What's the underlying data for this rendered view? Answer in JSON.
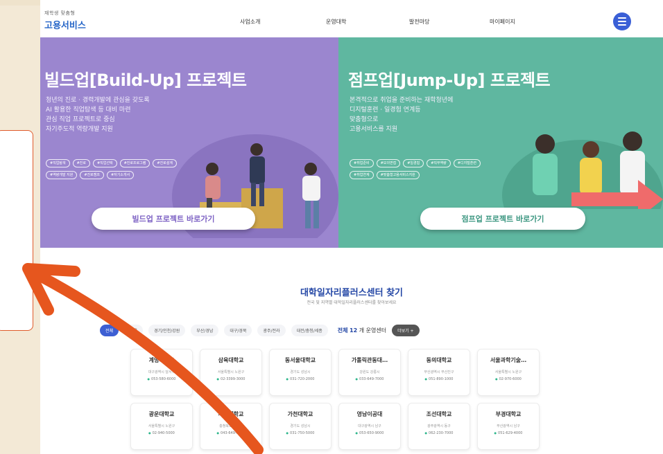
{
  "header": {
    "logo_sub": "재학생 맞춤형",
    "logo_main": "고용서비스",
    "nav": [
      "사업소개",
      "운영대학",
      "발전마당",
      "마이페이지"
    ],
    "menu_icon": "hamburger-menu-icon"
  },
  "hero_left": {
    "title": "빌드업[Build-Up] 프로젝트",
    "desc": [
      "청년의 진로 · 경력개발에 관심을 갖도록",
      "AI 활용한 직업탐색 등 대비 마련",
      "관심 직업 프로젝트로 중심",
      "자기주도적 역량개발 지원"
    ],
    "tags": [
      "#직업탐색",
      "#진로",
      "#직업선택",
      "#진로프로그램",
      "#진로설계",
      "#역량개발 지원",
      "#진로캠프",
      "#자기소개서"
    ],
    "button": "빌드업 프로젝트 바로가기",
    "bg_color": "#9b86cf"
  },
  "hero_right": {
    "title": "점프업[Jump-Up] 프로젝트",
    "desc": [
      "본격적으로 취업을 준비하는 재학청년에",
      "디지털훈련 · 일경험 연계등",
      "맞춤형으로",
      "고용서비스를 지원"
    ],
    "tags": [
      "#취업준비",
      "#모의면접",
      "#일경험",
      "#직무역량",
      "#디지털훈련",
      "#취업연계",
      "#맞춤형고용서비스지원"
    ],
    "button": "점프업 프로젝트 바로가기",
    "bg_color": "#5fb7a0"
  },
  "finder": {
    "title": "대학일자리플러스센터 찾기",
    "subtitle": "전국 및 지역별 대학일자리플러스센터를 찾아보세요",
    "filters": [
      "전체",
      "서울",
      "경기/인천/강원",
      "부산/경남",
      "대구/경북",
      "광주/전라",
      "대전/충청/세종"
    ],
    "count_prefix": "전체",
    "count_suffix": "개 운영센터",
    "count_value": "12",
    "count_button": "더보기 +"
  },
  "universities": [
    {
      "name": "계명대학교",
      "addr": "대구광역시 달서구",
      "tel": "053-580-6000"
    },
    {
      "name": "삼육대학교",
      "addr": "서울특별시 노원구",
      "tel": "02-3399-3000"
    },
    {
      "name": "동서울대학교",
      "addr": "경기도 성남시",
      "tel": "031-720-2000"
    },
    {
      "name": "가톨릭관동대…",
      "addr": "강원도 강릉시",
      "tel": "033-649-7000"
    },
    {
      "name": "동의대학교",
      "addr": "부산광역시 부산진구",
      "tel": "051-890-1000"
    },
    {
      "name": "서울과학기술…",
      "addr": "서울특별시 노원구",
      "tel": "02-970-6000"
    },
    {
      "name": "광운대학교",
      "addr": "서울특별시 노원구",
      "tel": "02-940-5000"
    },
    {
      "name": "세명대학교",
      "addr": "충청북도 제천시",
      "tel": "043-649-1000"
    },
    {
      "name": "가천대학교",
      "addr": "경기도 성남시",
      "tel": "031-750-5000"
    },
    {
      "name": "영남이공대",
      "addr": "대구광역시 남구",
      "tel": "053-650-9000"
    },
    {
      "name": "조선대학교",
      "addr": "광주광역시 동구",
      "tel": "062-230-7000"
    },
    {
      "name": "부경대학교",
      "addr": "부산광역시 남구",
      "tel": "051-629-4000"
    }
  ],
  "annotation": {
    "arrow_color": "#e6561e",
    "callout_border": "#e05a2a"
  }
}
